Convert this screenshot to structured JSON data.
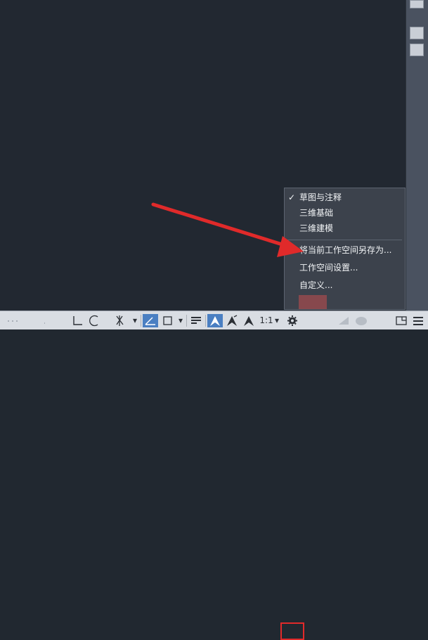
{
  "workspace_menu": {
    "items": [
      {
        "label": "草图与注释",
        "checked": true
      },
      {
        "label": "三维基础",
        "checked": false
      },
      {
        "label": "三维建模",
        "checked": false
      }
    ],
    "actions": [
      {
        "label": "将当前工作空间另存为..."
      },
      {
        "label": "工作空间设置..."
      },
      {
        "label": "自定义..."
      }
    ],
    "check_glyph": "✓"
  },
  "statusbar": {
    "annotation_scale": "1:1",
    "dropdown_glyph": "▾",
    "icons": [
      "grid-icon",
      "ortho-icon",
      "polar-icon",
      "osnap-icon",
      "dynamic-ucs-icon",
      "selection-cycling-icon",
      "lineweight-icon",
      "annotation-visibility-icon",
      "auto-scale-icon",
      "annotation-scale-icon",
      "workspace-gear-icon",
      "isolate-icon",
      "hardware-accel-icon",
      "clean-screen-icon",
      "customization-icon"
    ]
  },
  "colors": {
    "canvas": "#222831",
    "menu_bg": "#3c424c",
    "highlight": "#e12a2a",
    "active_toggle": "#4a7fc2"
  }
}
